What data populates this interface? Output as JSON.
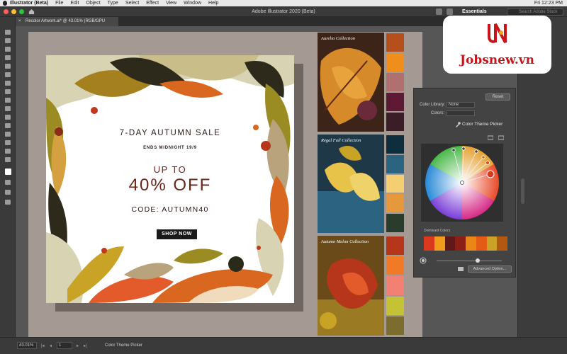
{
  "menubar": {
    "items": [
      "Illustrator (Beta)",
      "File",
      "Edit",
      "Object",
      "Type",
      "Select",
      "Effect",
      "View",
      "Window",
      "Help"
    ],
    "clock": "Fri 12:23 PM"
  },
  "app": {
    "title": "Adobe Illustrator 2020 (Beta)",
    "workspace": "Essentials",
    "search_placeholder": "Search Adobe Stock"
  },
  "document": {
    "tab_label": "Recolor Artwork.ai* @ 43.01% (RGB/GPU Preview)"
  },
  "poster": {
    "headline": "7-DAY AUTUMN SALE",
    "subline": "ENDS MIDNIGHT 19/9",
    "up_to": "UP TO",
    "discount": "40% OFF",
    "code": "CODE: AUTUMN40",
    "cta": "SHOP NOW"
  },
  "collections": [
    {
      "label": "Aurelia Collection",
      "swatches": [
        "#b5501c",
        "#f08e1c",
        "#b07070",
        "#5e1a34",
        "#3b1d28"
      ]
    },
    {
      "label": "Regal Fall Collection",
      "swatches": [
        "#0f2e3d",
        "#2b6380",
        "#f3cf72",
        "#e5993b",
        "#2a3d2c"
      ]
    },
    {
      "label": "Autumn Melon Collection",
      "swatches": [
        "#b6361b",
        "#f07a25",
        "#f28073",
        "#c5c236",
        "#7c6c2e"
      ]
    }
  ],
  "color_panel": {
    "reset_label": "Reset",
    "library_label": "Color Library:",
    "library_value": "None",
    "colors_label": "Colors:",
    "colors_value": "",
    "theme_picker_label": "Color Theme Picker",
    "dominant_label": "Dominant Colors",
    "dominant_colors": [
      "#d93a1e",
      "#f09b1a",
      "#5e1a1a",
      "#8a1f14",
      "#e88616",
      "#e55c17",
      "#c9a326",
      "#b25813"
    ],
    "advanced_label": "Advanced Option..."
  },
  "logo": {
    "brand": "Jobsnew.vn",
    "mark": "JN"
  },
  "status": {
    "zoom": "43.01%",
    "page": "1",
    "tool": "Color Theme Picker"
  },
  "colors": {
    "accent_red": "#c8141b"
  }
}
